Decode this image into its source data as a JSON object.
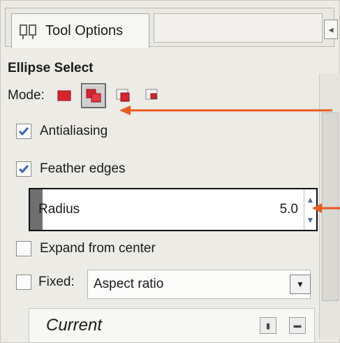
{
  "tab": {
    "title": "Tool Options",
    "icon": "tool-options-icon"
  },
  "section": {
    "title": "Ellipse Select"
  },
  "mode": {
    "label": "Mode:",
    "buttons": [
      {
        "name": "replace-mode-icon",
        "active": false
      },
      {
        "name": "add-mode-icon",
        "active": true
      },
      {
        "name": "subtract-mode-icon",
        "active": false
      },
      {
        "name": "intersect-mode-icon",
        "active": false
      }
    ]
  },
  "options": {
    "antialiasing": {
      "label": "Antialiasing",
      "checked": true
    },
    "feather": {
      "label": "Feather edges",
      "checked": true
    },
    "expand": {
      "label": "Expand from center",
      "checked": false
    },
    "fixed": {
      "label": "Fixed:",
      "checked": false
    }
  },
  "radius": {
    "label": "Radius",
    "value": "5.0"
  },
  "aspect": {
    "selected": "Aspect ratio"
  },
  "current": {
    "text": "Current"
  },
  "colors": {
    "accent_orange": "#e55b1f",
    "mode_red": "#d9232f",
    "check_blue": "#3a63b7"
  }
}
